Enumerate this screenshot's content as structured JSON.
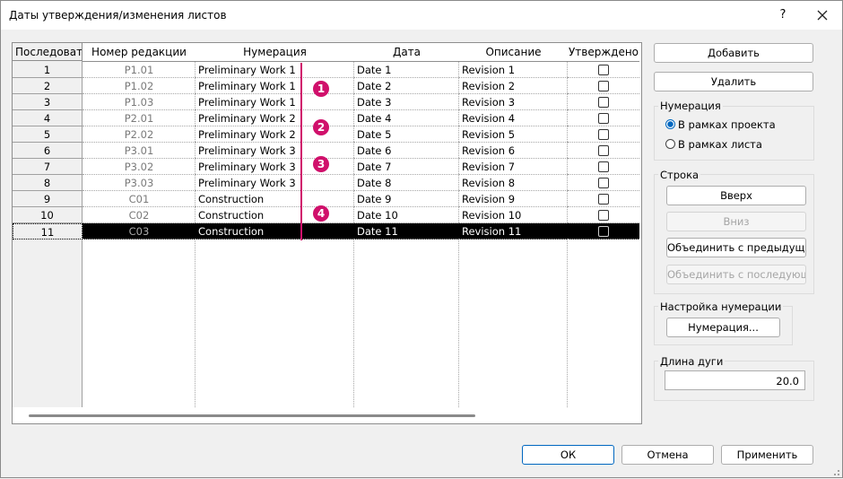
{
  "window": {
    "title": "Даты утверждения/изменения листов",
    "help_label": "?",
    "close_icon": "close-icon"
  },
  "table": {
    "headers": {
      "seq": "Последовате",
      "revision": "Номер редакции",
      "numbering": "Нумерация",
      "date": "Дата",
      "description": "Описание",
      "issued": "Утверждено"
    },
    "rows": [
      {
        "seq": "1",
        "revision": "P1.01",
        "numbering": "Preliminary Work 1",
        "date": "Date 1",
        "description": "Revision 1",
        "issued": false
      },
      {
        "seq": "2",
        "revision": "P1.02",
        "numbering": "Preliminary Work 1",
        "date": "Date 2",
        "description": "Revision 2",
        "issued": false
      },
      {
        "seq": "3",
        "revision": "P1.03",
        "numbering": "Preliminary Work 1",
        "date": "Date 3",
        "description": "Revision 3",
        "issued": false
      },
      {
        "seq": "4",
        "revision": "P2.01",
        "numbering": "Preliminary Work 2",
        "date": "Date 4",
        "description": "Revision 4",
        "issued": false
      },
      {
        "seq": "5",
        "revision": "P2.02",
        "numbering": "Preliminary Work 2",
        "date": "Date 5",
        "description": "Revision 5",
        "issued": false
      },
      {
        "seq": "6",
        "revision": "P3.01",
        "numbering": "Preliminary Work 3",
        "date": "Date 6",
        "description": "Revision 6",
        "issued": false
      },
      {
        "seq": "7",
        "revision": "P3.02",
        "numbering": "Preliminary Work 3",
        "date": "Date 7",
        "description": "Revision 7",
        "issued": false
      },
      {
        "seq": "8",
        "revision": "P3.03",
        "numbering": "Preliminary Work 3",
        "date": "Date 8",
        "description": "Revision 8",
        "issued": false
      },
      {
        "seq": "9",
        "revision": "C01",
        "numbering": "Construction",
        "date": "Date 9",
        "description": "Revision 9",
        "issued": false
      },
      {
        "seq": "10",
        "revision": "C02",
        "numbering": "Construction",
        "date": "Date 10",
        "description": "Revision 10",
        "issued": false
      },
      {
        "seq": "11",
        "revision": "C03",
        "numbering": "Construction",
        "date": "Date 11",
        "description": "Revision 11",
        "issued": false,
        "selected": true
      }
    ],
    "markers": [
      "1",
      "2",
      "3",
      "4"
    ],
    "marker_color": "#d0106b"
  },
  "side": {
    "add_label": "Добавить",
    "delete_label": "Удалить",
    "numbering_group": {
      "title": "Нумерация",
      "options": [
        "В рамках проекта",
        "В рамках листа"
      ],
      "selected": "В рамках проекта"
    },
    "row_group": {
      "title": "Строка",
      "up": "Вверх",
      "down": "Вниз",
      "merge_prev": "Объединить с предыдущим",
      "merge_next": "Объединить с последующим"
    },
    "settings_group": {
      "title": "Настройка нумерации",
      "button": "Нумерация..."
    },
    "arc_group": {
      "title": "Длина дуги",
      "value": "20.0"
    }
  },
  "footer": {
    "ok": "ОК",
    "cancel": "Отмена",
    "apply": "Применить"
  },
  "colors": {
    "accent": "#0067c0",
    "marker": "#d0106b"
  }
}
